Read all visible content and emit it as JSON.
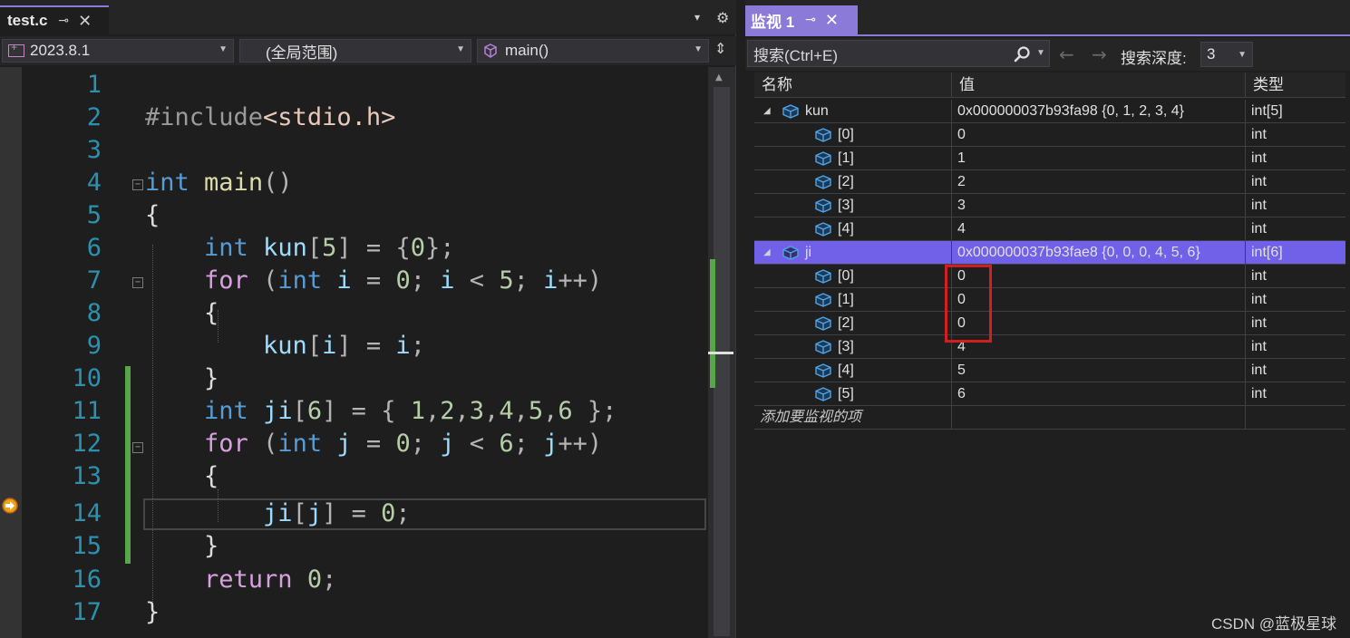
{
  "editor": {
    "tab_title": "test.c",
    "pin_glyph": "⊸",
    "close_glyph": "✕",
    "menu_glyph": "▾",
    "gear_glyph": "⚙",
    "nav": {
      "project": "2023.8.1",
      "scope": "(全局范围)",
      "function": "main()"
    },
    "line_numbers": [
      "1",
      "2",
      "3",
      "4",
      "5",
      "6",
      "7",
      "8",
      "9",
      "10",
      "11",
      "12",
      "13",
      "14",
      "15",
      "16",
      "17"
    ]
  },
  "watch": {
    "tab_title": "监视 1",
    "search_placeholder": "搜索(Ctrl+E)",
    "depth_label": "搜索深度:",
    "depth_value": "3",
    "columns": [
      "名称",
      "值",
      "类型"
    ],
    "rows": [
      {
        "name": "kun",
        "value": "0x000000037b93fa98 {0, 1, 2, 3, 4}",
        "type": "int[5]",
        "level": 0,
        "expanded": true
      },
      {
        "name": "[0]",
        "value": "0",
        "type": "int",
        "level": 1
      },
      {
        "name": "[1]",
        "value": "1",
        "type": "int",
        "level": 1
      },
      {
        "name": "[2]",
        "value": "2",
        "type": "int",
        "level": 1
      },
      {
        "name": "[3]",
        "value": "3",
        "type": "int",
        "level": 1
      },
      {
        "name": "[4]",
        "value": "4",
        "type": "int",
        "level": 1
      },
      {
        "name": "ji",
        "value": "0x000000037b93fae8 {0, 0, 0, 4, 5, 6}",
        "type": "int[6]",
        "level": 0,
        "expanded": true,
        "selected": true
      },
      {
        "name": "[0]",
        "value": "0",
        "type": "int",
        "level": 1
      },
      {
        "name": "[1]",
        "value": "0",
        "type": "int",
        "level": 1
      },
      {
        "name": "[2]",
        "value": "0",
        "type": "int",
        "level": 1
      },
      {
        "name": "[3]",
        "value": "4",
        "type": "int",
        "level": 1
      },
      {
        "name": "[4]",
        "value": "5",
        "type": "int",
        "level": 1
      },
      {
        "name": "[5]",
        "value": "6",
        "type": "int",
        "level": 1
      }
    ],
    "add_watch": "添加要监视的项"
  },
  "watermark": "CSDN @蓝极星球",
  "colors": {
    "accent": "#8b7ad8",
    "selected_row": "#7160e8",
    "highlight_box": "#d11f1f",
    "change_bar": "#57a64a"
  }
}
